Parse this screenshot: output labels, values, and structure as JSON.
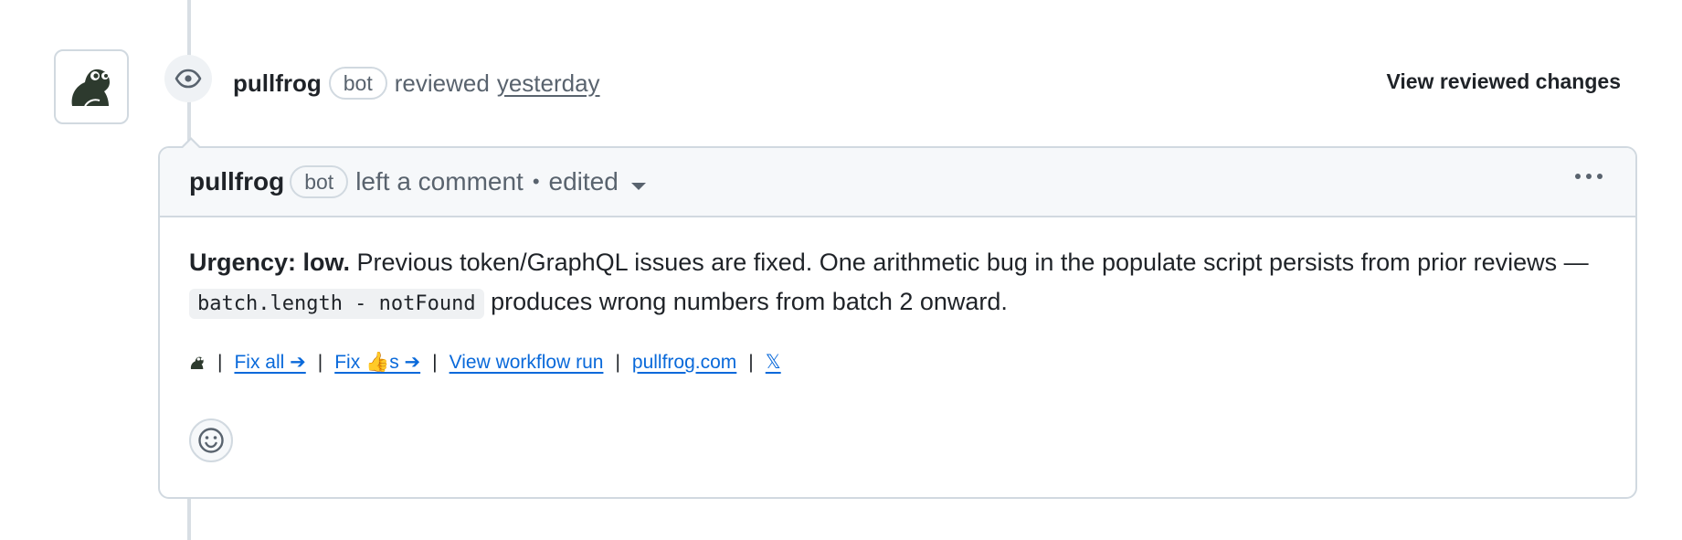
{
  "review": {
    "author": "pullfrog",
    "badge": "bot",
    "action": "reviewed",
    "timestamp": "yesterday",
    "view_changes_label": "View reviewed changes"
  },
  "comment": {
    "author": "pullfrog",
    "badge": "bot",
    "action": "left a comment",
    "separator": "•",
    "edited_label": "edited",
    "body_bold": "Urgency: low.",
    "body_text_1": " Previous token/GraphQL issues are fixed. One arithmetic bug in the populate script persists from prior reviews — ",
    "body_code": "batch.length - notFound",
    "body_text_2": " produces wrong numbers from batch 2 onward.",
    "links": [
      {
        "label": "Fix all ➔"
      },
      {
        "label": "Fix 👍s ➔"
      },
      {
        "label": "View workflow run"
      },
      {
        "label": "pullfrog.com"
      },
      {
        "label": "𝕏"
      }
    ],
    "separator_pipe": "|"
  },
  "icons": {
    "avatar": "frog-icon",
    "timeline": "eye-icon",
    "menu": "kebab-horizontal-icon",
    "reaction": "smiley-icon",
    "dropdown": "triangle-down-icon"
  },
  "colors": {
    "link": "#0969da",
    "muted": "#59636e",
    "border": "#d1d9e0",
    "header_bg": "#f6f8fa",
    "frog": "#2d3a2e"
  }
}
